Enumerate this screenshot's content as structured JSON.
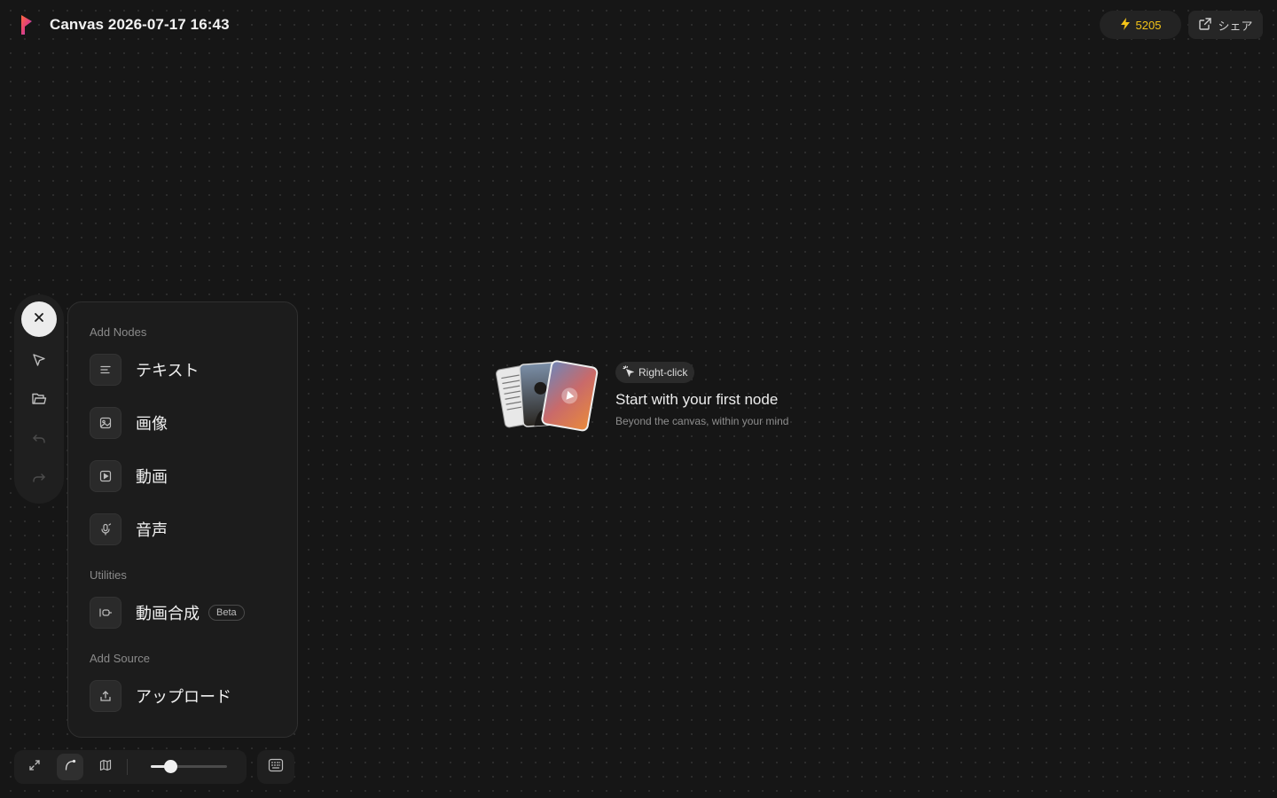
{
  "header": {
    "logo_icon": "app-logo",
    "title": "Canvas 2026-07-17 16:43",
    "credits": {
      "icon": "lightning-icon",
      "value": "5205",
      "color": "#f5c518"
    },
    "share": {
      "icon": "external-link-icon",
      "label": "シェア"
    }
  },
  "left_toolbar": {
    "items": [
      {
        "name": "close",
        "icon": "close-icon"
      },
      {
        "name": "select",
        "icon": "pointer-icon"
      },
      {
        "name": "open",
        "icon": "folder-icon"
      },
      {
        "name": "undo",
        "icon": "undo-icon",
        "disabled": true
      },
      {
        "name": "redo",
        "icon": "redo-icon",
        "disabled": true
      }
    ]
  },
  "menu": {
    "add_nodes_label": "Add Nodes",
    "add_nodes": [
      {
        "icon": "text-icon",
        "label": "テキスト"
      },
      {
        "icon": "image-icon",
        "label": "画像"
      },
      {
        "icon": "video-icon",
        "label": "動画"
      },
      {
        "icon": "audio-icon",
        "label": "音声"
      }
    ],
    "utilities_label": "Utilities",
    "utilities": [
      {
        "icon": "video-compose-icon",
        "label": "動画合成",
        "badge": "Beta"
      }
    ],
    "add_source_label": "Add Source",
    "add_source": [
      {
        "icon": "upload-icon",
        "label": "アップロード"
      }
    ]
  },
  "empty_state": {
    "badge": {
      "icon": "click-icon",
      "label": "Right-click"
    },
    "title": "Start with your first node",
    "subtitle": "Beyond the canvas, within your mind"
  },
  "bottom_bar": {
    "buttons": [
      {
        "name": "fit-view",
        "icon": "expand-icon"
      },
      {
        "name": "edge-style",
        "icon": "curve-icon",
        "active": true
      },
      {
        "name": "minimap",
        "icon": "map-icon"
      }
    ],
    "zoom_fraction": 0.25,
    "keyboard_icon": "keyboard-icon"
  },
  "colors": {
    "background": "#161616",
    "accent": "#f5c518",
    "panel": "#1c1c1c"
  }
}
